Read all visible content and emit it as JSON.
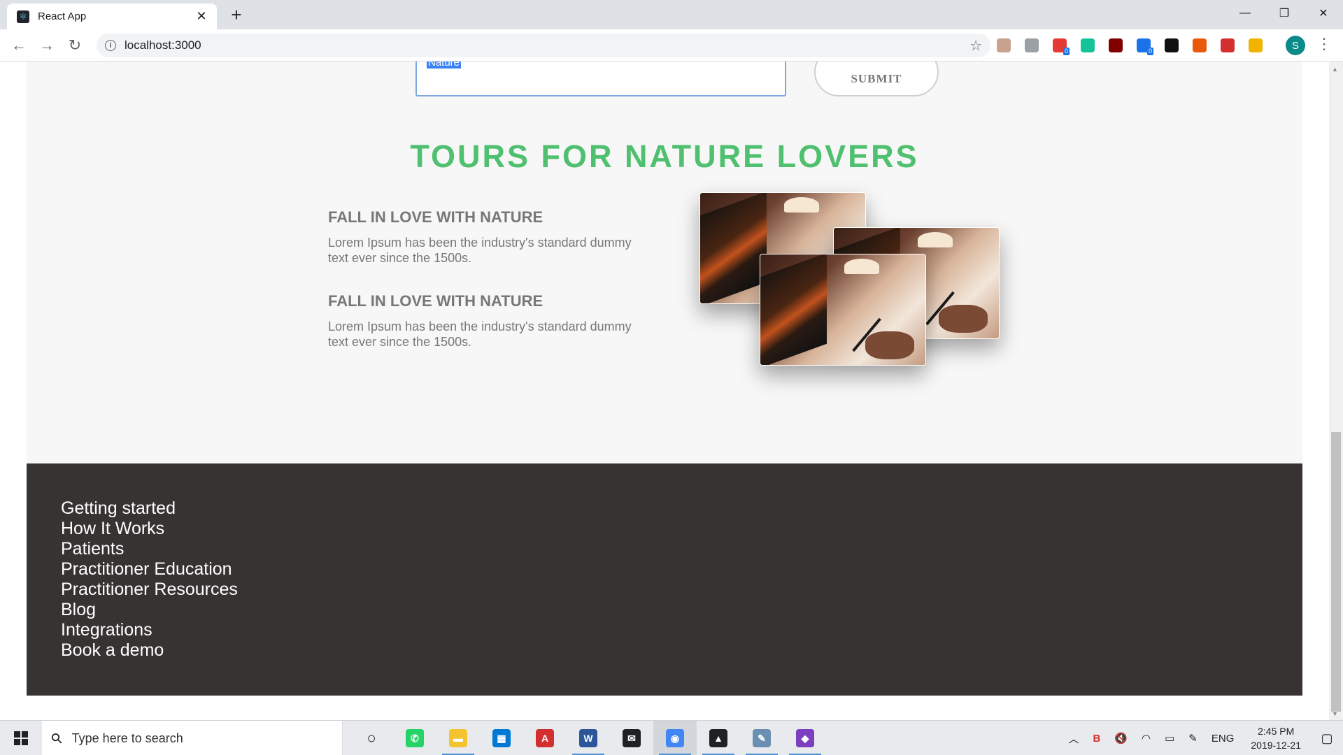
{
  "browser": {
    "tab_title": "React App",
    "url": "localhost:3000",
    "extensions": [
      {
        "name": "pdf-ext-icon",
        "color": "#c8a18f",
        "badge": ""
      },
      {
        "name": "translate-ext-icon",
        "color": "#9aa0a6",
        "badge": ""
      },
      {
        "name": "grammar-ext-icon",
        "color": "#e53935",
        "badge": "0"
      },
      {
        "name": "grammarly-ext-icon",
        "color": "#15c39a",
        "badge": ""
      },
      {
        "name": "ublock-ext-icon",
        "color": "#800000",
        "badge": ""
      },
      {
        "name": "social-ext-icon",
        "color": "#1a73e8",
        "badge": "0"
      },
      {
        "name": "shield-ext-icon",
        "color": "#111111",
        "badge": ""
      },
      {
        "name": "office-ext-icon",
        "color": "#e8590c",
        "badge": ""
      },
      {
        "name": "pdf-red-ext-icon",
        "color": "#d32f2f",
        "badge": ""
      },
      {
        "name": "json-ext-icon",
        "color": "#f0b400",
        "badge": ""
      }
    ],
    "profile_initial": "S"
  },
  "form": {
    "input_value": "Nature",
    "submit_label": "SUBMIT"
  },
  "section": {
    "title": "TOURS FOR NATURE LOVERS",
    "features": [
      {
        "heading": "FALL IN LOVE WITH NATURE",
        "text": "Lorem Ipsum has been the industry's standard dummy text ever since the 1500s."
      },
      {
        "heading": "FALL IN LOVE WITH NATURE",
        "text": "Lorem Ipsum has been the industry's standard dummy text ever since the 1500s."
      }
    ]
  },
  "footer": {
    "links": [
      "Getting started",
      "How It Works",
      "Patients",
      "Practitioner Education",
      "Practitioner Resources",
      "Blog",
      "Integrations",
      "Book a demo"
    ]
  },
  "taskbar": {
    "search_placeholder": "Type here to search",
    "apps": [
      {
        "name": "cortana-icon",
        "color": "#202124",
        "glyph": "○",
        "active": false,
        "open": false
      },
      {
        "name": "whatsapp-icon",
        "color": "#25d366",
        "glyph": "✆",
        "active": false,
        "open": false
      },
      {
        "name": "file-explorer-icon",
        "color": "#f4c430",
        "glyph": "▬",
        "active": false,
        "open": true
      },
      {
        "name": "store-icon",
        "color": "#0078d4",
        "glyph": "▦",
        "active": false,
        "open": false
      },
      {
        "name": "acrobat-icon",
        "color": "#d32f2f",
        "glyph": "A",
        "active": false,
        "open": false
      },
      {
        "name": "word-icon",
        "color": "#2b579a",
        "glyph": "W",
        "active": false,
        "open": true
      },
      {
        "name": "mail-icon",
        "color": "#202124",
        "glyph": "✉",
        "active": false,
        "open": false
      },
      {
        "name": "chrome-icon",
        "color": "#4285f4",
        "glyph": "◉",
        "active": true,
        "open": true
      },
      {
        "name": "photos-icon",
        "color": "#202124",
        "glyph": "▲",
        "active": false,
        "open": true
      },
      {
        "name": "paint-icon",
        "color": "#6b8fb3",
        "glyph": "✎",
        "active": false,
        "open": true
      },
      {
        "name": "git-icon",
        "color": "#7b3fbf",
        "glyph": "◆",
        "active": false,
        "open": true
      }
    ],
    "language": "ENG",
    "time": "2:45 PM",
    "date": "2019-12-21"
  }
}
